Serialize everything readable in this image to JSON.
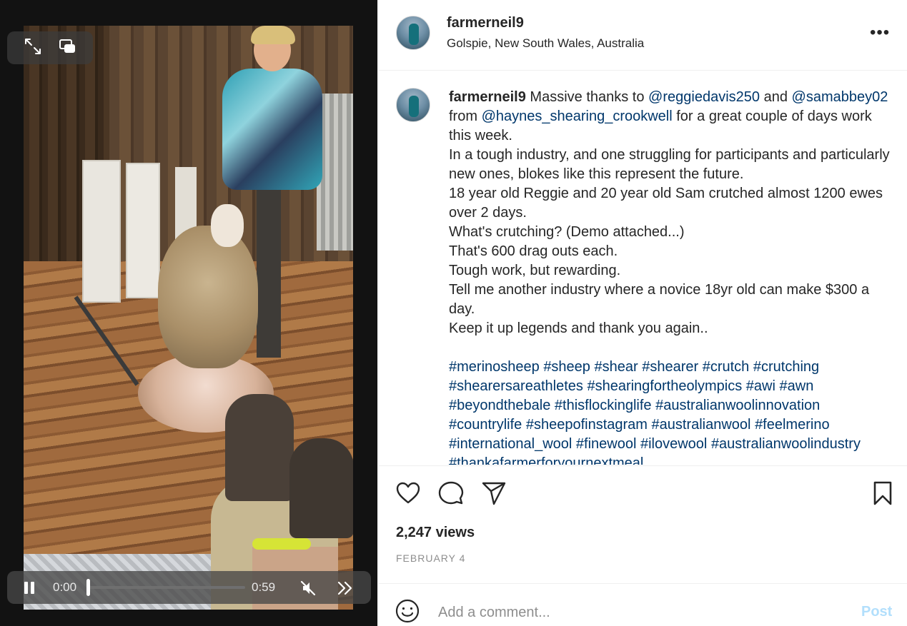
{
  "player": {
    "current_time": "0:00",
    "duration": "0:59",
    "progress": 0.0,
    "icons": [
      "expand-icon",
      "picture-in-picture-icon",
      "pause-icon",
      "mute-icon",
      "skip-forward-icon"
    ]
  },
  "post": {
    "username": "farmerneil9",
    "location": "Golspie, New South Wales, Australia",
    "caption": {
      "author": "farmerneil9",
      "line1_a": "Massive thanks to",
      "mention1": "@reggiedavis250",
      "line1_b": "and",
      "mention2": "@samabbey02",
      "line2_a": "from",
      "mention3": "@haynes_shearing_crookwell",
      "line2_b": "for a great couple of days work this week.",
      "para2": "In a tough industry, and one struggling for participants and particularly new ones, blokes like this represent the future.",
      "para3": "18 year old Reggie and 20 year old Sam crutched almost 1200 ewes over 2 days.",
      "para4": "What's crutching? (Demo attached...)",
      "para5": "That's 600 drag outs each.",
      "para6": "Tough work, but rewarding.",
      "para7": "Tell me another industry where a novice 18yr old can make $300 a day.",
      "para8": "Keep it up legends and thank you again..",
      "hashtags": [
        "#merinosheep",
        "#sheep",
        "#shear",
        "#shearer",
        "#crutch",
        "#crutching",
        "#shearersareathletes",
        "#shearingfortheolympics",
        "#awi",
        "#awn",
        "#beyondthebale",
        "#thisflockinglife",
        "#australianwoolinnovation",
        "#countrylife",
        "#sheepofinstagram",
        "#australianwool",
        "#feelmerino",
        "#international_wool",
        "#finewool",
        "#ilovewool",
        "#australianwoolindustry",
        "#thankafarmerforyournextmeal"
      ]
    },
    "views": "2,247 views",
    "date": "FEBRUARY 4",
    "more_label": "•••"
  },
  "comment": {
    "placeholder": "Add a comment...",
    "post_label": "Post"
  },
  "colors": {
    "link": "#00376b",
    "post_disabled": "#b2dffc",
    "muted": "#8e8e8e"
  }
}
